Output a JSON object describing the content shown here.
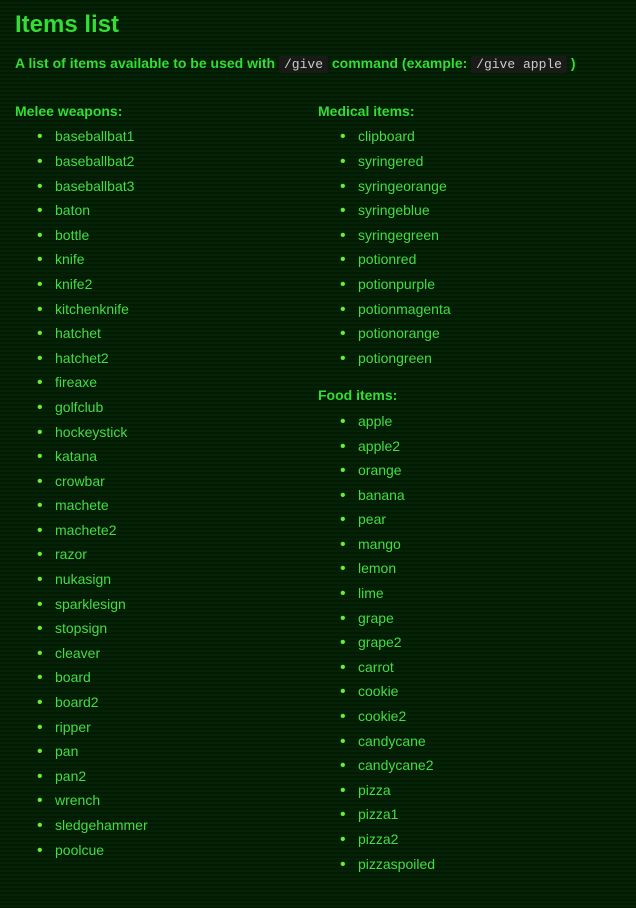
{
  "title": "Items list",
  "description_prefix": "A list of items available to be used with ",
  "cmd1": "/give",
  "description_mid": " command (example: ",
  "cmd2": "/give apple",
  "description_suffix": " )",
  "left": {
    "heading": "Melee weapons:",
    "items": [
      "baseballbat1",
      "baseballbat2",
      "baseballbat3",
      "baton",
      "bottle",
      "knife",
      "knife2",
      "kitchenknife",
      "hatchet",
      "hatchet2",
      "fireaxe",
      "golfclub",
      "hockeystick",
      "katana",
      "crowbar",
      "machete",
      "machete2",
      "razor",
      "nukasign",
      "sparklesign",
      "stopsign",
      "cleaver",
      "board",
      "board2",
      "ripper",
      "pan",
      "pan2",
      "wrench",
      "sledgehammer",
      "poolcue"
    ]
  },
  "right_a": {
    "heading": "Medical items:",
    "items": [
      "clipboard",
      "syringered",
      "syringeorange",
      "syringeblue",
      "syringegreen",
      "potionred",
      "potionpurple",
      "potionmagenta",
      "potionorange",
      "potiongreen"
    ]
  },
  "right_b": {
    "heading": "Food items:",
    "items": [
      "apple",
      "apple2",
      "orange",
      "banana",
      "pear",
      "mango",
      "lemon",
      "lime",
      "grape",
      "grape2",
      "carrot",
      "cookie",
      "cookie2",
      "candycane",
      "candycane2",
      "pizza",
      "pizza1",
      "pizza2",
      "pizzaspoiled"
    ]
  }
}
